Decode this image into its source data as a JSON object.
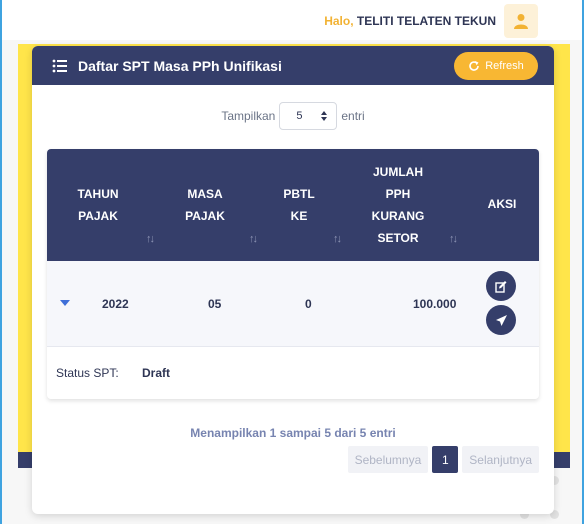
{
  "topbar": {
    "greeting": "Halo,",
    "user_name": "TELITI TELATEN TEKUN",
    "avatar_icon": "user-icon"
  },
  "card": {
    "title": "Daftar SPT Masa PPh Unifikasi",
    "title_icon": "list-icon",
    "refresh_label": "Refresh",
    "refresh_icon": "refresh-icon"
  },
  "show": {
    "prefix": "Tampilkan",
    "value": "5",
    "suffix": "entri"
  },
  "table": {
    "columns": [
      {
        "line1": "TAHUN",
        "line2": "PAJAK"
      },
      {
        "line1": "MASA",
        "line2": "PAJAK"
      },
      {
        "line1": "PBTL",
        "line2": "KE"
      },
      {
        "line1": "JUMLAH",
        "line2": "PPH",
        "line3": "KURANG",
        "line4": "SETOR"
      },
      {
        "line1": "AKSI"
      }
    ],
    "rows": [
      {
        "tahun": "2022",
        "masa": "05",
        "pbtl": "0",
        "jumlah": "100.000"
      }
    ],
    "detail": {
      "label": "Status SPT:",
      "value": "Draft"
    }
  },
  "footer": {
    "info": "Menampilkan 1 sampai 5 dari 5 entri",
    "prev": "Sebelumnya",
    "page": "1",
    "next": "Selanjutnya"
  },
  "colors": {
    "navy": "#353e6a",
    "accent": "#f8b733",
    "yellow_bg": "#ffe54a"
  }
}
